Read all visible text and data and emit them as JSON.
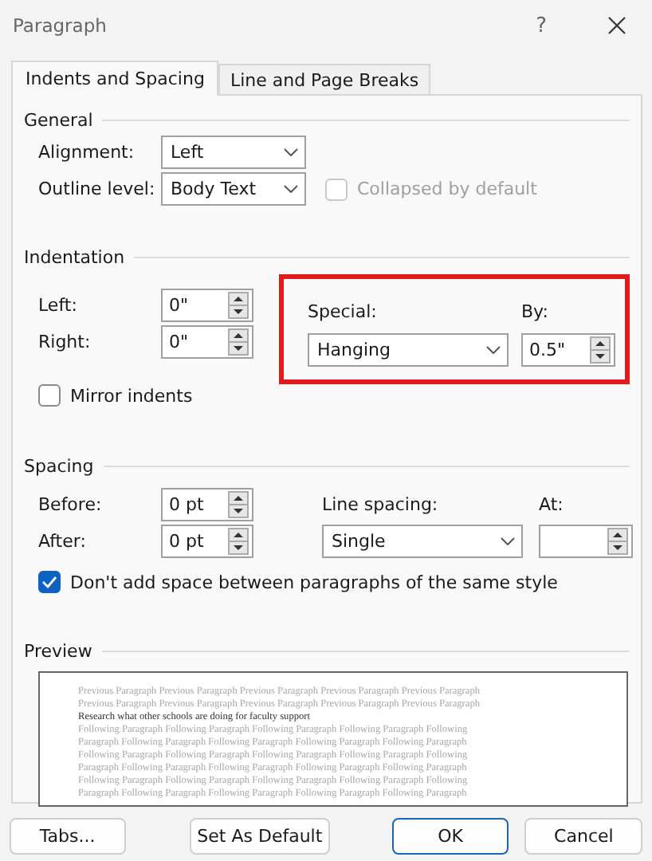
{
  "window": {
    "title": "Paragraph",
    "help": "?"
  },
  "tabs": [
    {
      "label": "Indents and Spacing",
      "selected": true
    },
    {
      "label": "Line and Page Breaks",
      "selected": false
    }
  ],
  "general": {
    "heading": "General",
    "alignment": {
      "label": "Alignment:",
      "value": "Left"
    },
    "outline_level": {
      "label": "Outline level:",
      "value": "Body Text"
    },
    "collapsed": {
      "label": "Collapsed by default",
      "checked": false,
      "disabled": true
    }
  },
  "indentation": {
    "heading": "Indentation",
    "left": {
      "label": "Left:",
      "value": "0\""
    },
    "right": {
      "label": "Right:",
      "value": "0\""
    },
    "special": {
      "label": "Special:",
      "value": "Hanging"
    },
    "by": {
      "label": "By:",
      "value": "0.5\""
    },
    "highlighted": true,
    "mirror": {
      "label": "Mirror indents",
      "checked": false
    }
  },
  "spacing": {
    "heading": "Spacing",
    "before": {
      "label": "Before:",
      "value": "0 pt"
    },
    "after": {
      "label": "After:",
      "value": "0 pt"
    },
    "line_spacing": {
      "label": "Line spacing:",
      "value": "Single"
    },
    "at": {
      "label": "At:"
    },
    "dont_add": {
      "label": "Don't add space between paragraphs of the same style",
      "checked": true
    }
  },
  "preview": {
    "heading": "Preview",
    "previous": [
      "Previous Paragraph Previous Paragraph Previous Paragraph Previous Paragraph Previous Paragraph",
      "Previous Paragraph Previous Paragraph Previous Paragraph Previous Paragraph Previous Paragraph"
    ],
    "current": "Research what other schools are doing for faculty support",
    "following": [
      "Following Paragraph Following Paragraph Following Paragraph Following Paragraph Following",
      "Paragraph Following Paragraph Following Paragraph Following Paragraph Following Paragraph",
      "Following Paragraph Following Paragraph Following Paragraph Following Paragraph Following",
      "Paragraph Following Paragraph Following Paragraph Following Paragraph Following Paragraph",
      "Following Paragraph Following Paragraph Following Paragraph Following Paragraph Following",
      "Paragraph Following Paragraph Following Paragraph Following Paragraph Following Paragraph"
    ]
  },
  "buttons": [
    {
      "label": "Tabs...",
      "kind": "normal"
    },
    {
      "label": "Set As Default",
      "kind": "normal"
    },
    {
      "label": "OK",
      "kind": "default"
    },
    {
      "label": "Cancel",
      "kind": "normal"
    }
  ]
}
